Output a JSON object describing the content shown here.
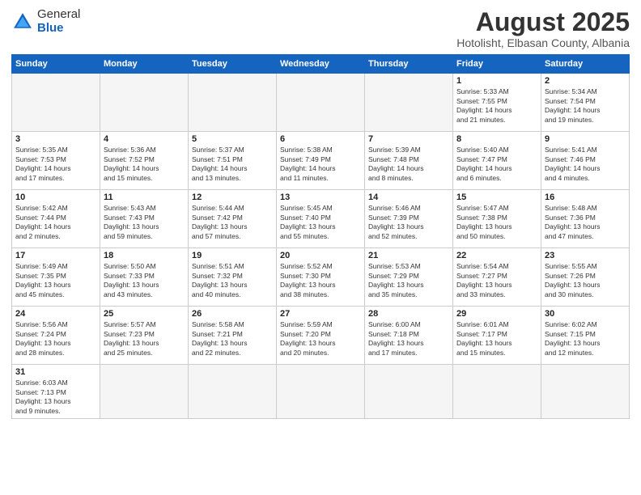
{
  "header": {
    "logo_general": "General",
    "logo_blue": "Blue",
    "month_year": "August 2025",
    "location": "Hotolisht, Elbasan County, Albania"
  },
  "days_of_week": [
    "Sunday",
    "Monday",
    "Tuesday",
    "Wednesday",
    "Thursday",
    "Friday",
    "Saturday"
  ],
  "weeks": [
    [
      {
        "day": "",
        "info": ""
      },
      {
        "day": "",
        "info": ""
      },
      {
        "day": "",
        "info": ""
      },
      {
        "day": "",
        "info": ""
      },
      {
        "day": "",
        "info": ""
      },
      {
        "day": "1",
        "info": "Sunrise: 5:33 AM\nSunset: 7:55 PM\nDaylight: 14 hours\nand 21 minutes."
      },
      {
        "day": "2",
        "info": "Sunrise: 5:34 AM\nSunset: 7:54 PM\nDaylight: 14 hours\nand 19 minutes."
      }
    ],
    [
      {
        "day": "3",
        "info": "Sunrise: 5:35 AM\nSunset: 7:53 PM\nDaylight: 14 hours\nand 17 minutes."
      },
      {
        "day": "4",
        "info": "Sunrise: 5:36 AM\nSunset: 7:52 PM\nDaylight: 14 hours\nand 15 minutes."
      },
      {
        "day": "5",
        "info": "Sunrise: 5:37 AM\nSunset: 7:51 PM\nDaylight: 14 hours\nand 13 minutes."
      },
      {
        "day": "6",
        "info": "Sunrise: 5:38 AM\nSunset: 7:49 PM\nDaylight: 14 hours\nand 11 minutes."
      },
      {
        "day": "7",
        "info": "Sunrise: 5:39 AM\nSunset: 7:48 PM\nDaylight: 14 hours\nand 8 minutes."
      },
      {
        "day": "8",
        "info": "Sunrise: 5:40 AM\nSunset: 7:47 PM\nDaylight: 14 hours\nand 6 minutes."
      },
      {
        "day": "9",
        "info": "Sunrise: 5:41 AM\nSunset: 7:46 PM\nDaylight: 14 hours\nand 4 minutes."
      }
    ],
    [
      {
        "day": "10",
        "info": "Sunrise: 5:42 AM\nSunset: 7:44 PM\nDaylight: 14 hours\nand 2 minutes."
      },
      {
        "day": "11",
        "info": "Sunrise: 5:43 AM\nSunset: 7:43 PM\nDaylight: 13 hours\nand 59 minutes."
      },
      {
        "day": "12",
        "info": "Sunrise: 5:44 AM\nSunset: 7:42 PM\nDaylight: 13 hours\nand 57 minutes."
      },
      {
        "day": "13",
        "info": "Sunrise: 5:45 AM\nSunset: 7:40 PM\nDaylight: 13 hours\nand 55 minutes."
      },
      {
        "day": "14",
        "info": "Sunrise: 5:46 AM\nSunset: 7:39 PM\nDaylight: 13 hours\nand 52 minutes."
      },
      {
        "day": "15",
        "info": "Sunrise: 5:47 AM\nSunset: 7:38 PM\nDaylight: 13 hours\nand 50 minutes."
      },
      {
        "day": "16",
        "info": "Sunrise: 5:48 AM\nSunset: 7:36 PM\nDaylight: 13 hours\nand 47 minutes."
      }
    ],
    [
      {
        "day": "17",
        "info": "Sunrise: 5:49 AM\nSunset: 7:35 PM\nDaylight: 13 hours\nand 45 minutes."
      },
      {
        "day": "18",
        "info": "Sunrise: 5:50 AM\nSunset: 7:33 PM\nDaylight: 13 hours\nand 43 minutes."
      },
      {
        "day": "19",
        "info": "Sunrise: 5:51 AM\nSunset: 7:32 PM\nDaylight: 13 hours\nand 40 minutes."
      },
      {
        "day": "20",
        "info": "Sunrise: 5:52 AM\nSunset: 7:30 PM\nDaylight: 13 hours\nand 38 minutes."
      },
      {
        "day": "21",
        "info": "Sunrise: 5:53 AM\nSunset: 7:29 PM\nDaylight: 13 hours\nand 35 minutes."
      },
      {
        "day": "22",
        "info": "Sunrise: 5:54 AM\nSunset: 7:27 PM\nDaylight: 13 hours\nand 33 minutes."
      },
      {
        "day": "23",
        "info": "Sunrise: 5:55 AM\nSunset: 7:26 PM\nDaylight: 13 hours\nand 30 minutes."
      }
    ],
    [
      {
        "day": "24",
        "info": "Sunrise: 5:56 AM\nSunset: 7:24 PM\nDaylight: 13 hours\nand 28 minutes."
      },
      {
        "day": "25",
        "info": "Sunrise: 5:57 AM\nSunset: 7:23 PM\nDaylight: 13 hours\nand 25 minutes."
      },
      {
        "day": "26",
        "info": "Sunrise: 5:58 AM\nSunset: 7:21 PM\nDaylight: 13 hours\nand 22 minutes."
      },
      {
        "day": "27",
        "info": "Sunrise: 5:59 AM\nSunset: 7:20 PM\nDaylight: 13 hours\nand 20 minutes."
      },
      {
        "day": "28",
        "info": "Sunrise: 6:00 AM\nSunset: 7:18 PM\nDaylight: 13 hours\nand 17 minutes."
      },
      {
        "day": "29",
        "info": "Sunrise: 6:01 AM\nSunset: 7:17 PM\nDaylight: 13 hours\nand 15 minutes."
      },
      {
        "day": "30",
        "info": "Sunrise: 6:02 AM\nSunset: 7:15 PM\nDaylight: 13 hours\nand 12 minutes."
      }
    ],
    [
      {
        "day": "31",
        "info": "Sunrise: 6:03 AM\nSunset: 7:13 PM\nDaylight: 13 hours\nand 9 minutes."
      },
      {
        "day": "",
        "info": ""
      },
      {
        "day": "",
        "info": ""
      },
      {
        "day": "",
        "info": ""
      },
      {
        "day": "",
        "info": ""
      },
      {
        "day": "",
        "info": ""
      },
      {
        "day": "",
        "info": ""
      }
    ]
  ]
}
